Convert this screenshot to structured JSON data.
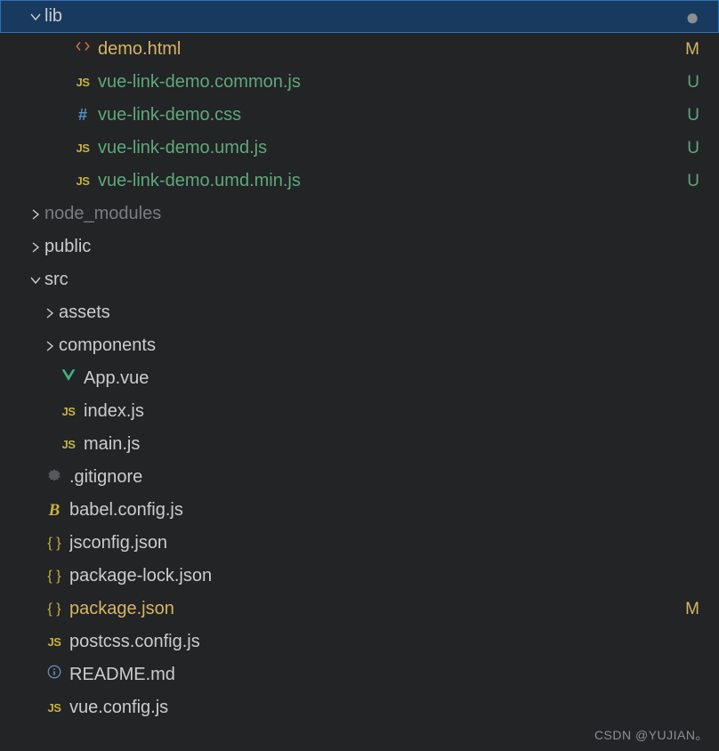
{
  "watermark": "CSDN @YUJIAN。",
  "tree": [
    {
      "name": "lib",
      "type": "folder",
      "expanded": true,
      "indent": 0,
      "selected": true,
      "dot": true
    },
    {
      "name": "demo.html",
      "type": "html",
      "indent": 2,
      "git": "M",
      "gitClass": "modified"
    },
    {
      "name": "vue-link-demo.common.js",
      "type": "js",
      "indent": 2,
      "git": "U",
      "gitClass": "untracked"
    },
    {
      "name": "vue-link-demo.css",
      "type": "css",
      "indent": 2,
      "git": "U",
      "gitClass": "untracked"
    },
    {
      "name": "vue-link-demo.umd.js",
      "type": "js",
      "indent": 2,
      "git": "U",
      "gitClass": "untracked"
    },
    {
      "name": "vue-link-demo.umd.min.js",
      "type": "js",
      "indent": 2,
      "git": "U",
      "gitClass": "untracked"
    },
    {
      "name": "node_modules",
      "type": "folder",
      "expanded": false,
      "indent": 0,
      "dim": true
    },
    {
      "name": "public",
      "type": "folder",
      "expanded": false,
      "indent": 0
    },
    {
      "name": "src",
      "type": "folder",
      "expanded": true,
      "indent": 0
    },
    {
      "name": "assets",
      "type": "folder",
      "expanded": false,
      "indent": 1
    },
    {
      "name": "components",
      "type": "folder",
      "expanded": false,
      "indent": 1
    },
    {
      "name": "App.vue",
      "type": "vue",
      "indent": 1
    },
    {
      "name": "index.js",
      "type": "js",
      "indent": 1
    },
    {
      "name": "main.js",
      "type": "js",
      "indent": 1
    },
    {
      "name": ".gitignore",
      "type": "ignore",
      "indent": 0
    },
    {
      "name": "babel.config.js",
      "type": "babel",
      "indent": 0
    },
    {
      "name": "jsconfig.json",
      "type": "json",
      "indent": 0
    },
    {
      "name": "package-lock.json",
      "type": "json",
      "indent": 0
    },
    {
      "name": "package.json",
      "type": "json",
      "indent": 0,
      "git": "M",
      "gitClass": "modified"
    },
    {
      "name": "postcss.config.js",
      "type": "js",
      "indent": 0
    },
    {
      "name": "README.md",
      "type": "info",
      "indent": 0
    },
    {
      "name": "vue.config.js",
      "type": "js",
      "indent": 0
    }
  ],
  "icons": {
    "js": "JS",
    "css": "#",
    "json": "{ }"
  }
}
